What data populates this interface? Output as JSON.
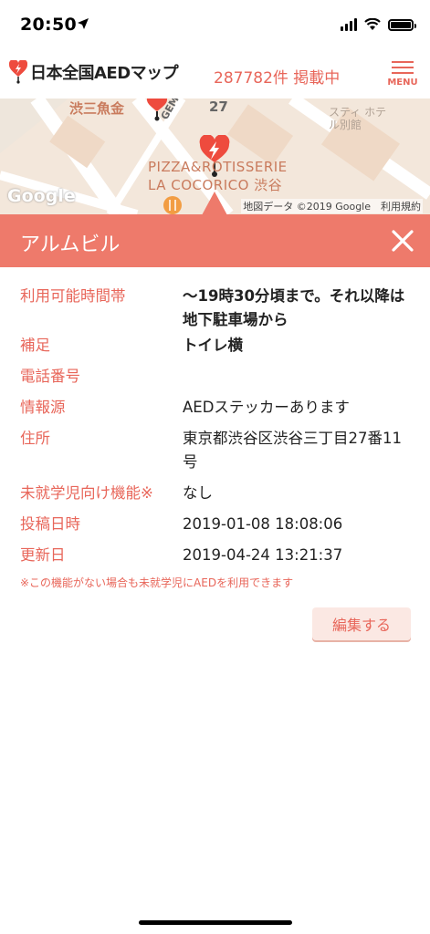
{
  "status_bar": {
    "time": "20:50"
  },
  "header": {
    "logo_text": "日本全国AEDマップ",
    "count_text": "287782件 掲載中",
    "menu_label": "MENU"
  },
  "map": {
    "labels": {
      "shop1": "渋三魚金",
      "street": "GEMS渋谷",
      "num": "27",
      "hotel": "スティ ホテル別館",
      "restaurant_line1": "PIZZA&ROTISSERIE",
      "restaurant_line2": "LA COCORICO 渋谷"
    },
    "google": "Google",
    "attribution": "地図データ ©2019 Google　利用規約"
  },
  "panel": {
    "title": "アルムビル",
    "rows": [
      {
        "label": "利用可能時間帯",
        "value": "〜19時30分頃まで。それ以降は地下駐車場から"
      },
      {
        "label": "補足",
        "value": "トイレ横"
      },
      {
        "label": "電話番号",
        "value": ""
      },
      {
        "label": "情報源",
        "value": "AEDステッカーあります"
      },
      {
        "label": "住所",
        "value": "東京都渋谷区渋谷三丁目27番11号"
      },
      {
        "label": "未就学児向け機能※",
        "value": "なし"
      },
      {
        "label": "投稿日時",
        "value": "2019-01-08 18:08:06"
      },
      {
        "label": "更新日",
        "value": "2019-04-24 13:21:37"
      }
    ],
    "note": "※この機能がない場合も未就学児にAEDを利用できます",
    "edit_label": "編集する"
  },
  "colors": {
    "accent": "#ee7a6b",
    "accent_text": "#e8665a"
  }
}
